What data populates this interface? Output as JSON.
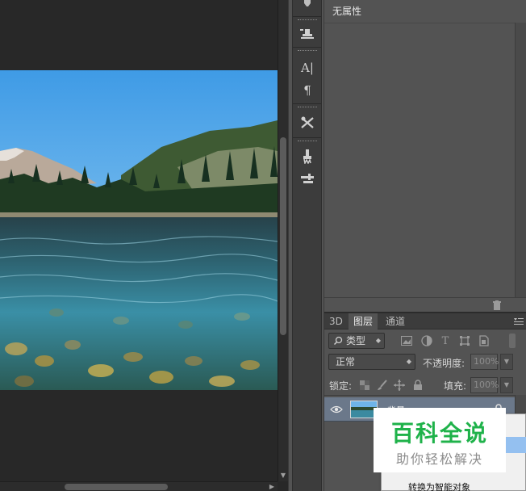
{
  "properties_panel": {
    "title": "无属性"
  },
  "layers_panel": {
    "tabs": [
      {
        "label": "3D",
        "active": false
      },
      {
        "label": "图层",
        "active": true
      },
      {
        "label": "通道",
        "active": false
      }
    ],
    "filter": {
      "label": "类型"
    },
    "blend_mode": "正常",
    "opacity_label": "不透明度:",
    "opacity_value": "100%",
    "lock_label": "锁定:",
    "fill_label": "填充:",
    "fill_value": "100%",
    "layer": {
      "name": "背景",
      "visible": true,
      "locked": true
    }
  },
  "context_menu": {
    "visible_item": "转换为智能对象"
  },
  "watermark": {
    "title": "百科全说",
    "subtitle": "助你轻松解决"
  },
  "colors": {
    "panel_bg": "#535353",
    "canvas_bg": "#282828",
    "selected_layer": "#6b788a",
    "watermark_green": "#1fb24a"
  }
}
